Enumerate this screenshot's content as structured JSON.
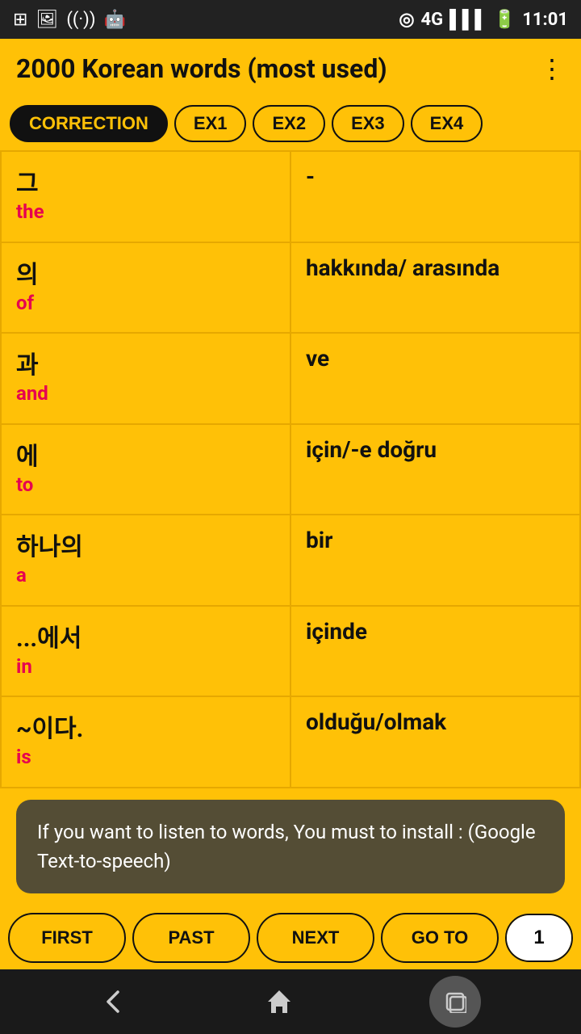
{
  "status": {
    "time": "11:01",
    "network": "4G",
    "icons_left": [
      "wifi-widget",
      "photo",
      "signal-wave",
      "android"
    ],
    "icons_right": [
      "location",
      "4g",
      "signal",
      "battery"
    ]
  },
  "title_bar": {
    "title": "2000 Korean words (most used)",
    "menu_icon": "⋮"
  },
  "tabs": [
    {
      "label": "CORRECTION",
      "active": true
    },
    {
      "label": "EX1",
      "active": false
    },
    {
      "label": "EX2",
      "active": false
    },
    {
      "label": "EX3",
      "active": false
    },
    {
      "label": "EX4",
      "active": false
    }
  ],
  "rows": [
    {
      "korean": "그",
      "english": "the",
      "translation": "-"
    },
    {
      "korean": "의",
      "english": "of",
      "translation": "hakkında/ arasında"
    },
    {
      "korean": "과",
      "english": "and",
      "translation": "ve"
    },
    {
      "korean": "에",
      "english": "to",
      "translation": "için/-e doğru"
    },
    {
      "korean": "하나의",
      "english": "a",
      "translation": "bir"
    },
    {
      "korean": "...에서",
      "english": "in",
      "translation": "içinde"
    },
    {
      "korean": "~이다.",
      "english": "is",
      "translation": "olduğu/olmak"
    }
  ],
  "toast": {
    "text": "If you want to listen to words, You must to install : (Google Text-to-speech)"
  },
  "nav_buttons": {
    "first": "FIRST",
    "past": "PAST",
    "next": "NEXT",
    "goto": "GO TO",
    "goto_value": "1"
  },
  "sys_nav": {
    "back_icon": "back",
    "home_icon": "home",
    "recents_icon": "recents"
  }
}
